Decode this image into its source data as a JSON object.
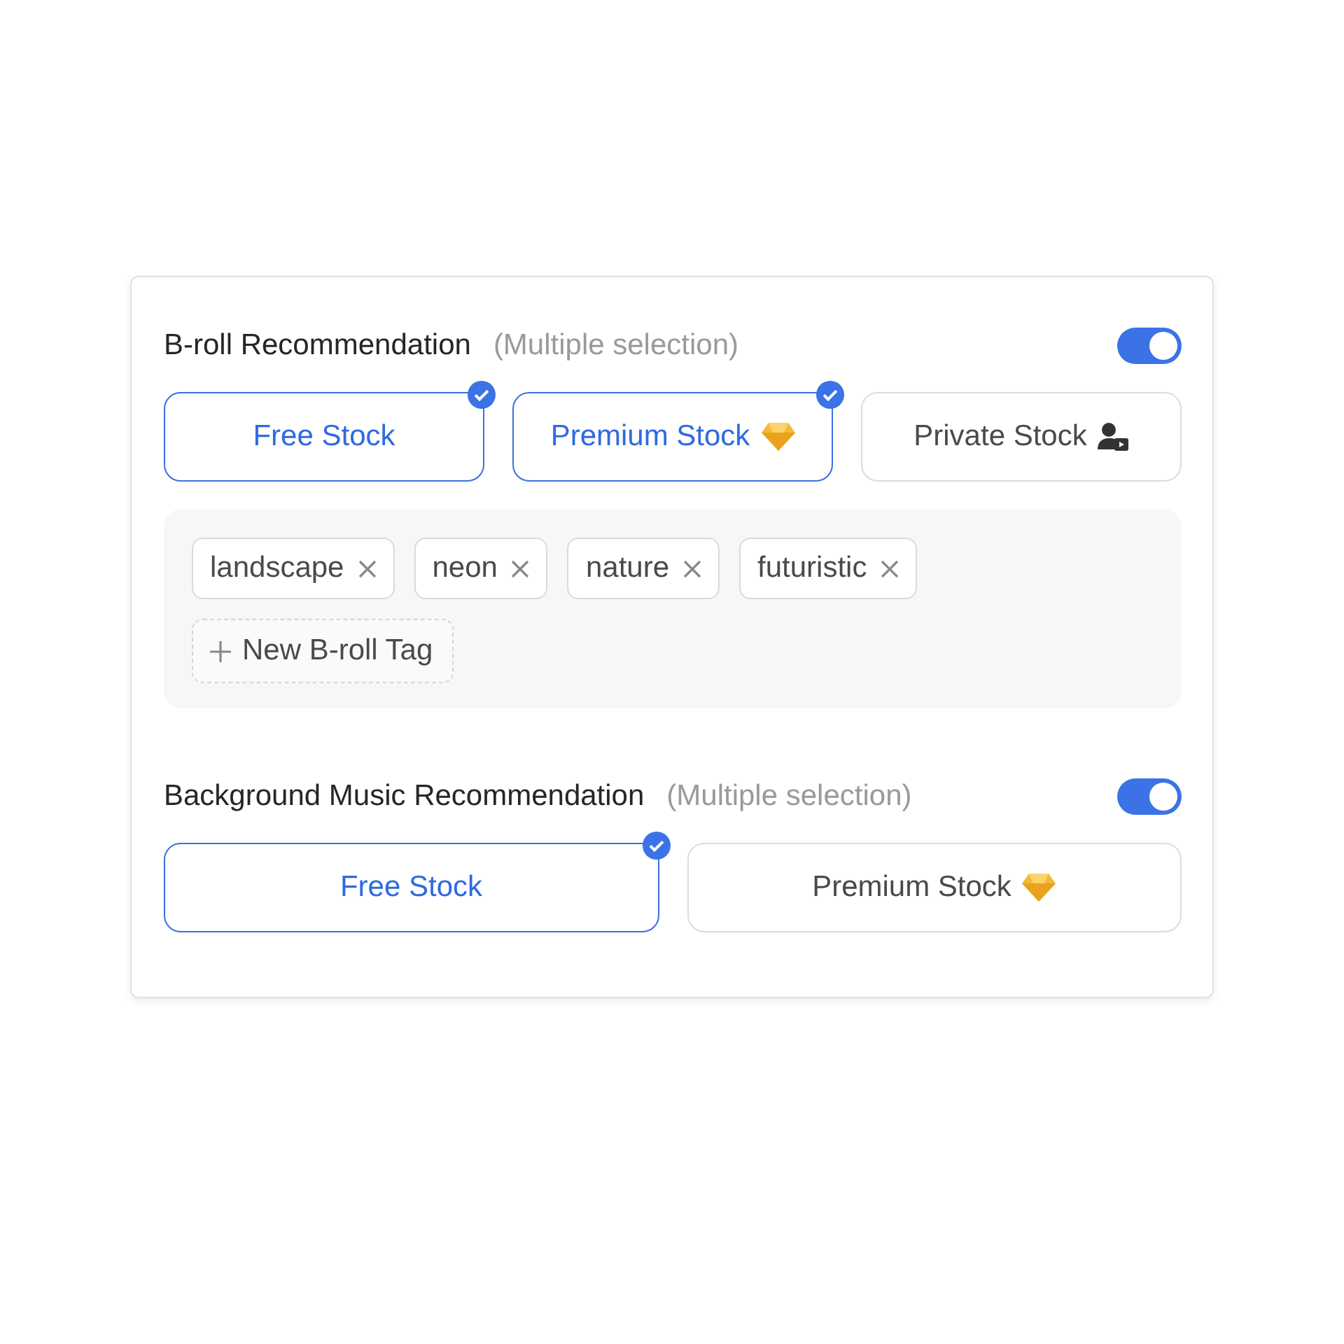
{
  "sections": [
    {
      "title": "B-roll Recommendation",
      "hint": "(Multiple selection)",
      "on": true,
      "options": [
        {
          "label": "Free Stock",
          "kind": "plain",
          "selected": true
        },
        {
          "label": "Premium Stock",
          "kind": "premium",
          "selected": true
        },
        {
          "label": "Private Stock",
          "kind": "private",
          "selected": false
        }
      ],
      "tags": [
        "landscape",
        "neon",
        "nature",
        "futuristic"
      ],
      "add_tag": "New B-roll Tag"
    },
    {
      "title": "Background Music Recommendation",
      "hint": "(Multiple selection)",
      "on": true,
      "options": [
        {
          "label": "Free Stock",
          "kind": "plain",
          "selected": true
        },
        {
          "label": "Premium Stock",
          "kind": "premium",
          "selected": false
        }
      ]
    }
  ]
}
